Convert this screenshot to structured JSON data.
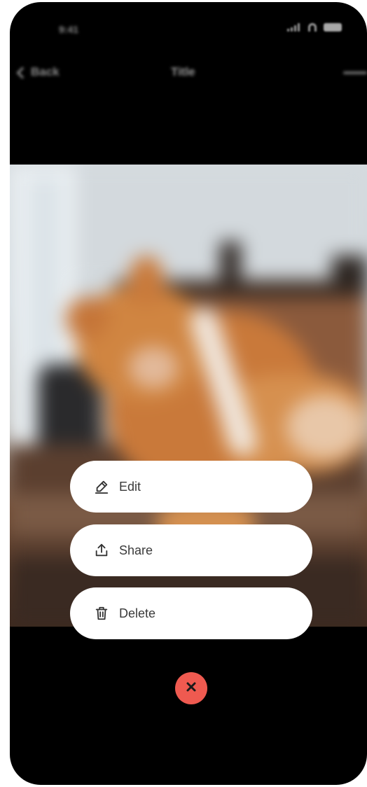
{
  "status_bar": {
    "time": "9:41"
  },
  "nav": {
    "back_label": "Back",
    "title": "Title"
  },
  "actions": [
    {
      "label": "Edit",
      "icon": "pencil-icon"
    },
    {
      "label": "Share",
      "icon": "share-icon"
    },
    {
      "label": "Delete",
      "icon": "trash-icon"
    }
  ],
  "close": {
    "icon": "close-icon",
    "color": "#ef5a50"
  },
  "colors": {
    "background": "#000000",
    "button": "#ffffff",
    "button_text": "#3a3a3a"
  }
}
